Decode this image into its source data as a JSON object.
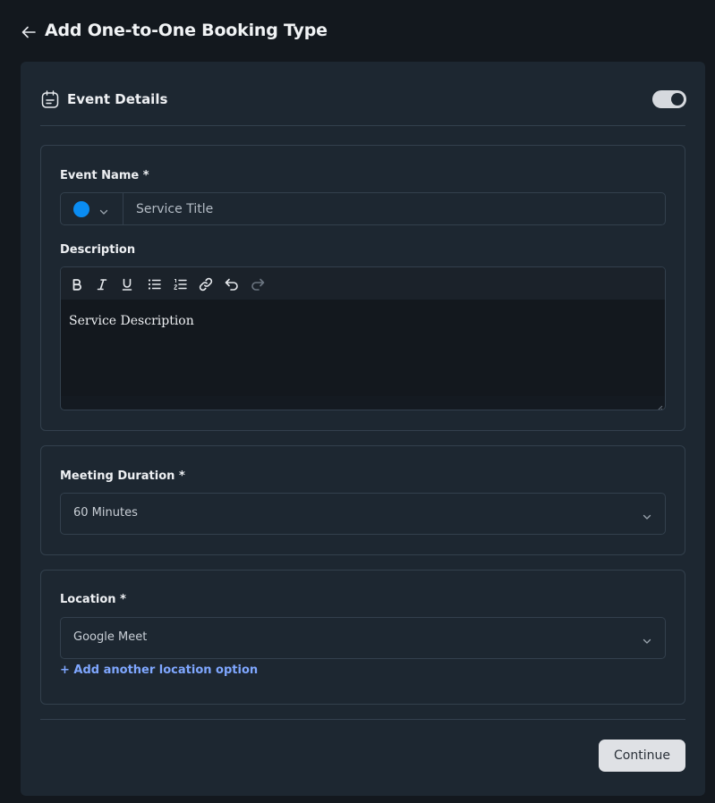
{
  "header": {
    "title": "Add One-to-One Booking Type"
  },
  "card": {
    "title": "Event Details",
    "toggle_on": true
  },
  "event_name": {
    "label": "Event Name *",
    "placeholder": "Service Title",
    "value": "",
    "color": "#0a8cf2"
  },
  "description": {
    "label": "Description",
    "content": "Service Description",
    "toolbar": [
      {
        "name": "bold-icon"
      },
      {
        "name": "italic-icon"
      },
      {
        "name": "underline-icon"
      },
      {
        "name": "bullet-list-icon"
      },
      {
        "name": "numbered-list-icon"
      },
      {
        "name": "link-icon"
      },
      {
        "name": "undo-icon"
      },
      {
        "name": "redo-icon"
      }
    ]
  },
  "duration": {
    "label": "Meeting Duration *",
    "value": "60 Minutes"
  },
  "location": {
    "label": "Location *",
    "value": "Google Meet",
    "add_link": "+ Add another location option"
  },
  "actions": {
    "continue_label": "Continue"
  },
  "colors": {
    "background": "#13181e",
    "card": "#1d2731",
    "border": "#33404d",
    "accent_link": "#7fa7ff",
    "button": "#dfe1e5"
  }
}
